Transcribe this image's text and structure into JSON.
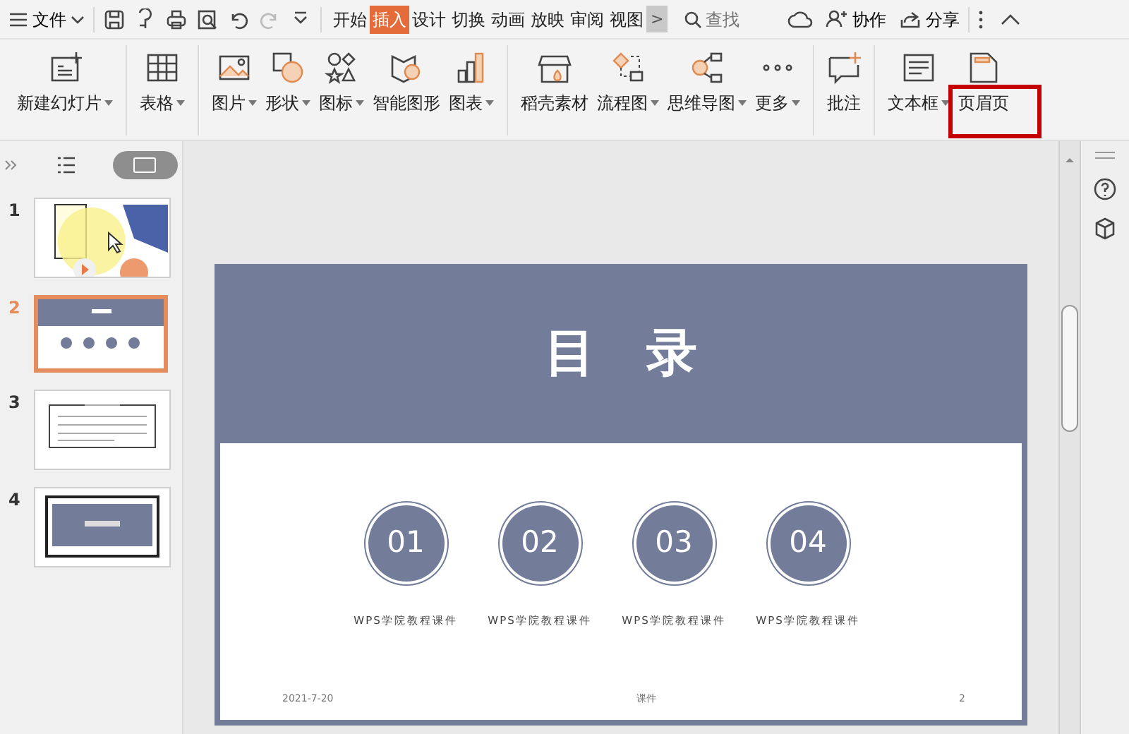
{
  "menu_bar": {
    "file_menu": "文件",
    "tabs": [
      {
        "label": "开始",
        "selected": false
      },
      {
        "label": "插入",
        "selected": true
      },
      {
        "label": "设计",
        "selected": false
      },
      {
        "label": "切换",
        "selected": false
      },
      {
        "label": "动画",
        "selected": false
      },
      {
        "label": "放映",
        "selected": false
      },
      {
        "label": "审阅",
        "selected": false
      },
      {
        "label": "视图",
        "selected": false
      }
    ],
    "more_tabs": ">",
    "search": {
      "placeholder": "查找"
    },
    "actions": [
      "协作",
      "分享"
    ]
  },
  "ribbon": {
    "groups": [
      [
        {
          "label": "新建幻灯片",
          "dropdown": true,
          "highlighted": false
        }
      ],
      [
        {
          "label": "表格",
          "dropdown": true,
          "highlighted": false
        }
      ],
      [
        {
          "label": "图片",
          "dropdown": true,
          "highlighted": false
        },
        {
          "label": "形状",
          "dropdown": true,
          "highlighted": false
        },
        {
          "label": "图标",
          "dropdown": true,
          "highlighted": false
        },
        {
          "label": "智能图形",
          "dropdown": false,
          "highlighted": false
        },
        {
          "label": "图表",
          "dropdown": true,
          "highlighted": false
        }
      ],
      [
        {
          "label": "稻壳素材",
          "dropdown": false,
          "highlighted": false
        },
        {
          "label": "流程图",
          "dropdown": true,
          "highlighted": false
        },
        {
          "label": "思维导图",
          "dropdown": true,
          "highlighted": false
        },
        {
          "label": "更多",
          "dropdown": true,
          "highlighted": false
        }
      ],
      [
        {
          "label": "批注",
          "dropdown": false,
          "highlighted": false
        }
      ],
      [
        {
          "label": "文本框",
          "dropdown": true,
          "highlighted": false
        },
        {
          "label": "页眉页",
          "dropdown": false,
          "highlighted": true
        }
      ]
    ]
  },
  "slides_panel": {
    "slides": [
      {
        "number": "1",
        "selected": false
      },
      {
        "number": "2",
        "selected": true
      },
      {
        "number": "3",
        "selected": false
      },
      {
        "number": "4",
        "selected": false
      }
    ]
  },
  "slide": {
    "title": "目　录",
    "items": [
      {
        "number": "01",
        "caption": "WPS学院教程课件"
      },
      {
        "number": "02",
        "caption": "WPS学院教程课件"
      },
      {
        "number": "03",
        "caption": "WPS学院教程课件"
      },
      {
        "number": "04",
        "caption": "WPS学院教程课件"
      }
    ],
    "footer": {
      "date": "2021-7-20",
      "center": "课件",
      "page": "2"
    }
  }
}
